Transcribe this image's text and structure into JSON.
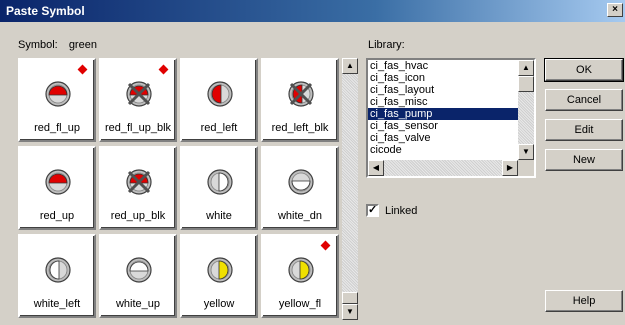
{
  "window": {
    "title": "Paste Symbol",
    "close_glyph": "×"
  },
  "symbol": {
    "caption": "Symbol:",
    "value": "green"
  },
  "tiles": [
    {
      "label": "red_fl_up",
      "icon": "red-up-circle-icon",
      "color": "#e00000",
      "dir": "up",
      "style": "solid",
      "flag": true
    },
    {
      "label": "red_fl_up_blk",
      "icon": "red-up-blocked-icon",
      "color": "#e00000",
      "dir": "up",
      "style": "blocked",
      "flag": true
    },
    {
      "label": "red_left",
      "icon": "red-left-circle-icon",
      "color": "#e00000",
      "dir": "left",
      "style": "solid",
      "flag": false
    },
    {
      "label": "red_left_blk",
      "icon": "red-left-blocked-icon",
      "color": "#e00000",
      "dir": "left",
      "style": "blocked",
      "flag": false
    },
    {
      "label": "red_up",
      "icon": "red-up-circle-icon",
      "color": "#e00000",
      "dir": "up",
      "style": "solid",
      "flag": false
    },
    {
      "label": "red_up_blk",
      "icon": "red-up-blocked-icon",
      "color": "#e00000",
      "dir": "up",
      "style": "blocked",
      "flag": false
    },
    {
      "label": "white",
      "icon": "white-right-circle-icon",
      "color": "#ffffff",
      "dir": "right",
      "style": "solid",
      "flag": false
    },
    {
      "label": "white_dn",
      "icon": "white-down-circle-icon",
      "color": "#ffffff",
      "dir": "down",
      "style": "solid",
      "flag": false
    },
    {
      "label": "white_left",
      "icon": "white-left-circle-icon",
      "color": "#ffffff",
      "dir": "left",
      "style": "solid",
      "flag": false
    },
    {
      "label": "white_up",
      "icon": "white-up-circle-icon",
      "color": "#ffffff",
      "dir": "up",
      "style": "solid",
      "flag": false
    },
    {
      "label": "yellow",
      "icon": "yellow-right-circle-icon",
      "color": "#f0e000",
      "dir": "right",
      "style": "solid",
      "flag": false
    },
    {
      "label": "yellow_fl",
      "icon": "yellow-right-circle-icon",
      "color": "#f0e000",
      "dir": "right",
      "style": "solid",
      "flag": true
    }
  ],
  "library": {
    "caption": "Library:",
    "items": [
      "ci_fas_hvac",
      "ci_fas_icon",
      "ci_fas_layout",
      "ci_fas_misc",
      "ci_fas_pump",
      "ci_fas_sensor",
      "ci_fas_valve",
      "cicode"
    ],
    "selected_index": 4
  },
  "linked": {
    "label": "Linked",
    "checked": true,
    "check_glyph": "✓"
  },
  "buttons": {
    "ok": "OK",
    "cancel": "Cancel",
    "edit": "Edit",
    "new": "New",
    "help": "Help"
  },
  "scroll_glyphs": {
    "up": "▲",
    "down": "▼",
    "left": "◀",
    "right": "▶"
  },
  "colors": {
    "title_start": "#0a246a",
    "selection": "#0a246a",
    "flag": "#e00000"
  }
}
